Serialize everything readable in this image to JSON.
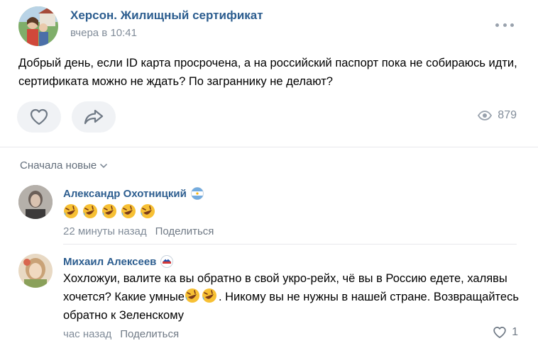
{
  "post": {
    "group_name": "Херсон. Жилищный сертификат",
    "time": "вчера в 10:41",
    "text": "Добрый день, если ID карта просрочена, а на российский паспорт пока не собираюсь идти, сертификата можно не ждать? По заграннику не делают?",
    "views": "879"
  },
  "comments_header": {
    "sort_label": "Сначала новые"
  },
  "comments": [
    {
      "author": "Александр Охотницкий",
      "emoji_count": 5,
      "time": "22 минуты назад",
      "share_label": "Поделиться"
    },
    {
      "author": "Михаил Алексеев",
      "text_part1": "Хохложуи, валите ка вы обратно в свой укро-рейх, чё вы в Россию едете, халявы хочется? Какие умные",
      "text_part2": ". Никому вы не нужны в нашей стране. Возвращайтесь обратно к Зеленскому",
      "time": "час назад",
      "share_label": "Поделиться",
      "likes": "1"
    }
  ]
}
